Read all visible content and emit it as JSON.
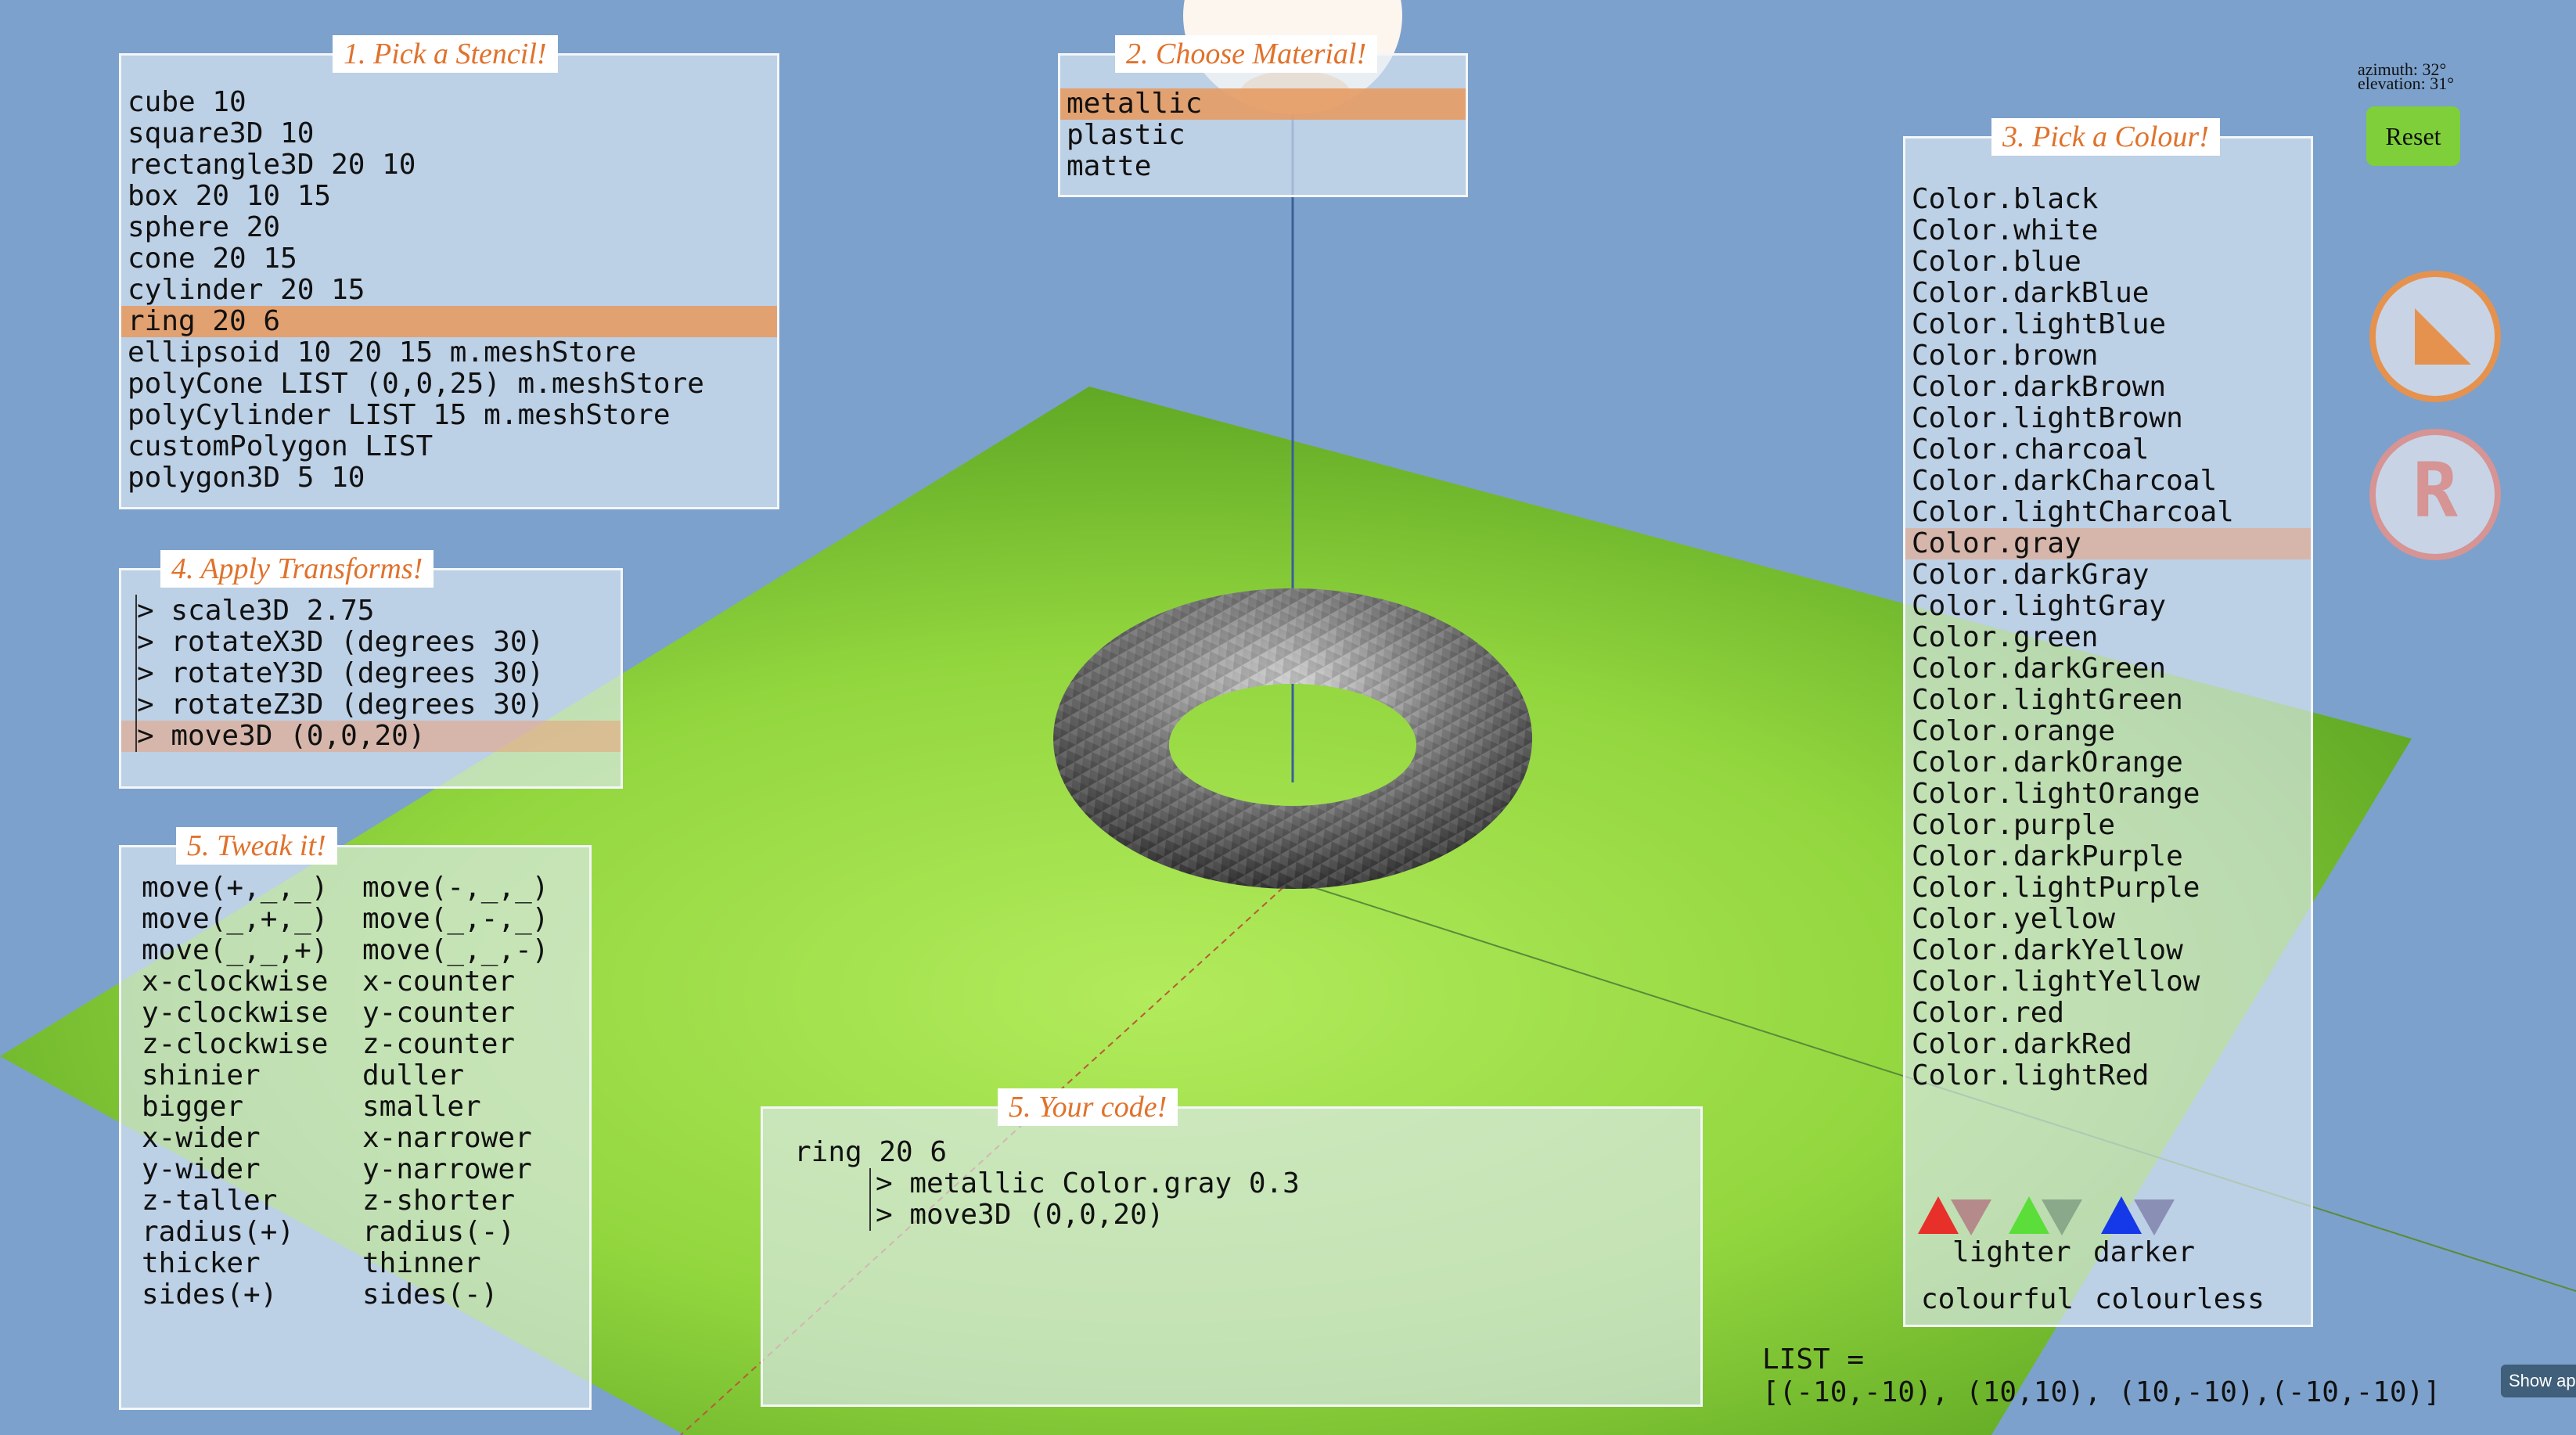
{
  "stencil": {
    "title": "1. Pick a Stencil!",
    "items": [
      "cube 10",
      "square3D 10",
      "rectangle3D 20 10",
      "box 20 10 15",
      "sphere 20",
      "cone 20 15",
      "cylinder 20 15",
      "ring 20 6",
      "ellipsoid 10 20 15 m.meshStore",
      "polyCone LIST (0,0,25) m.meshStore",
      "polyCylinder LIST 15 m.meshStore",
      "customPolygon LIST",
      "polygon3D 5 10"
    ],
    "selected": "ring 20 6"
  },
  "material": {
    "title": "2. Choose Material!",
    "items": [
      "metallic",
      "plastic",
      "matte"
    ],
    "selected": "metallic"
  },
  "colour": {
    "title": "3. Pick a Colour!",
    "items": [
      "Color.black",
      "Color.white",
      "Color.blue",
      "Color.darkBlue",
      "Color.lightBlue",
      "Color.brown",
      "Color.darkBrown",
      "Color.lightBrown",
      "Color.charcoal",
      "Color.darkCharcoal",
      "Color.lightCharcoal",
      "Color.gray",
      "Color.darkGray",
      "Color.lightGray",
      "Color.green",
      "Color.darkGreen",
      "Color.lightGreen",
      "Color.orange",
      "Color.darkOrange",
      "Color.lightOrange",
      "Color.purple",
      "Color.darkPurple",
      "Color.lightPurple",
      "Color.yellow",
      "Color.darkYellow",
      "Color.lightYellow",
      "Color.red",
      "Color.darkRed",
      "Color.lightRed"
    ],
    "selected": "Color.gray",
    "lighter_label": "lighter",
    "darker_label": "darker",
    "colourful_label": "colourful",
    "colourless_label": "colourless"
  },
  "transforms": {
    "title": "4. Apply Transforms!",
    "items": [
      "scale3D 2.75",
      "rotateX3D (degrees 30)",
      "rotateY3D (degrees 30)",
      "rotateZ3D (degrees 30)",
      "move3D (0,0,20)"
    ],
    "selected": "move3D (0,0,20)"
  },
  "tweak": {
    "title": "5. Tweak it!",
    "left": [
      "move(+,_,_)",
      "move(_,+,_)",
      "move(_,_,+)",
      "x-clockwise",
      "y-clockwise",
      "z-clockwise",
      "shinier",
      "bigger",
      "x-wider",
      "y-wider",
      "z-taller",
      "radius(+)",
      "thicker",
      "sides(+)"
    ],
    "right": [
      "move(-,_,_)",
      "move(_,-,_)",
      "move(_,_,-)",
      "x-counter",
      "y-counter",
      "z-counter",
      "duller",
      "smaller",
      "x-narrower",
      "y-narrower",
      "z-shorter",
      "radius(-)",
      "thinner",
      "sides(-)"
    ]
  },
  "code": {
    "title": "5. Your code!",
    "line1": "ring 20 6",
    "line2": "> metallic Color.gray 0.3",
    "line3": "> move3D (0,0,20)"
  },
  "camera": {
    "azimuth": "azimuth: 32°",
    "elevation": "elevation: 31°",
    "reset_label": "Reset"
  },
  "list_def": {
    "line1": "LIST =",
    "line2": "[(-10,-10), (10,10), (10,-10),(-10,-10)]"
  },
  "show_app_label": "Show ap",
  "icons": {
    "triangle_button": "triangle-icon",
    "r_button": "letter-r-icon"
  },
  "colors": {
    "background": "#7ca1cc",
    "ground": "#8dd23c",
    "title_orange": "#e0722c",
    "selection": "#e69b64",
    "reset_green": "#7fcf3a"
  }
}
